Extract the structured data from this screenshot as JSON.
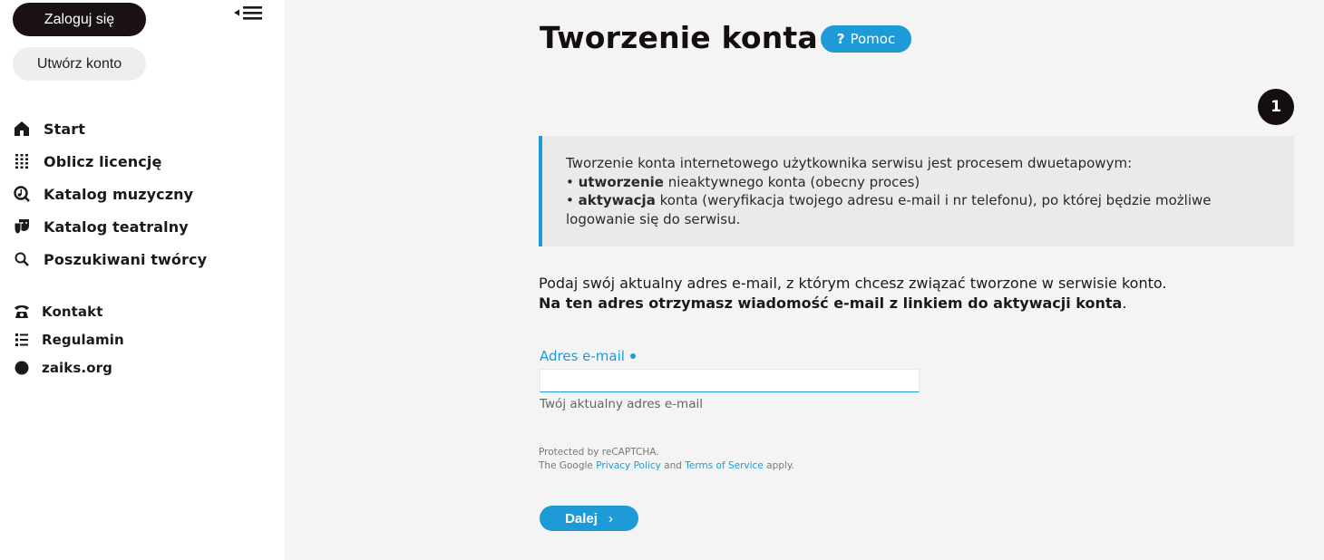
{
  "sidebar": {
    "login_label": "Zaloguj się",
    "create_label": "Utwórz konto",
    "main_items": [
      {
        "label": "Start",
        "icon": "home-icon"
      },
      {
        "label": "Oblicz licencję",
        "icon": "calculator-icon"
      },
      {
        "label": "Katalog muzyczny",
        "icon": "music-catalog-icon"
      },
      {
        "label": "Katalog teatralny",
        "icon": "theater-masks-icon"
      },
      {
        "label": "Poszukiwani twórcy",
        "icon": "search-icon"
      }
    ],
    "secondary_items": [
      {
        "label": "Kontakt",
        "icon": "phone-icon"
      },
      {
        "label": "Regulamin",
        "icon": "list-icon"
      },
      {
        "label": "zaiks.org",
        "icon": "globe-icon"
      }
    ]
  },
  "main": {
    "title": "Tworzenie konta",
    "help_label": "Pomoc",
    "help_icon": "?",
    "step_number": "1",
    "info": {
      "line1": "Tworzenie konta internetowego użytkownika serwisu jest procesem dwuetapowym:",
      "bullet": "•",
      "item1_strong": "utworzenie",
      "item1_rest": "nieaktywnego konta (obecny proces)",
      "item2_strong": "aktywacja",
      "item2_rest": "konta (weryfikacja twojego adresu e-mail i nr telefonu), po której będzie możliwe logowanie się do serwisu."
    },
    "intro_line1": "Podaj swój aktualny adres e-mail, z którym chcesz związać tworzone w serwisie konto.",
    "intro_line2": "Na ten adres otrzymasz wiadomość e-mail z linkiem do aktywacji konta",
    "intro_period": ".",
    "email_label": "Adres e-mail",
    "email_value": "",
    "email_hint": "Twój aktualny adres e-mail",
    "recaptcha_line1": "Protected by reCAPTCHA.",
    "recaptcha_the_google": "The Google",
    "recaptcha_privacy": "Privacy Policy",
    "recaptcha_and": "and",
    "recaptcha_terms": "Terms of Service",
    "recaptcha_apply": "apply.",
    "next_label": "Dalej",
    "next_chevron": "›"
  },
  "colors": {
    "accent": "#1e9ad6",
    "dark": "#140e0e",
    "sidebar_bg": "#ffffff",
    "page_bg": "#f4f4f4",
    "info_bg": "#ece9e9"
  }
}
